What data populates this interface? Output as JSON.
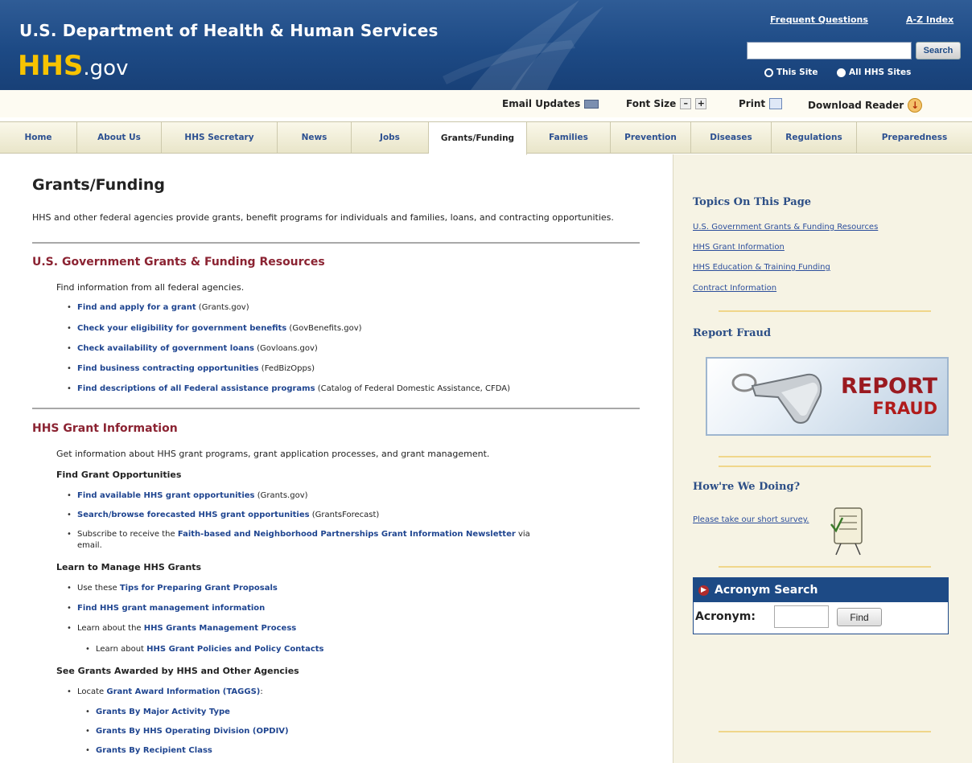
{
  "header": {
    "dept_title": "U.S. Department of Health & Human Services",
    "logo_hhs": "HHS",
    "logo_gov": ".gov",
    "faq_link": "Frequent Questions",
    "az_link": "A-Z Index",
    "search_placeholder": "",
    "search_button": "Search",
    "radio_this": "This Site",
    "radio_all": "All HHS Sites"
  },
  "utility": {
    "email": "Email Updates",
    "font_size": "Font Size",
    "font_minus": "–",
    "font_plus": "+",
    "print": "Print",
    "download": "Download Reader"
  },
  "nav": {
    "tabs": [
      {
        "label": "Home"
      },
      {
        "label": "About Us"
      },
      {
        "label": "HHS Secretary"
      },
      {
        "label": "News"
      },
      {
        "label": "Jobs"
      },
      {
        "label": "Grants/Funding"
      },
      {
        "label": "Families"
      },
      {
        "label": "Prevention"
      },
      {
        "label": "Diseases"
      },
      {
        "label": "Regulations"
      },
      {
        "label": "Preparedness"
      }
    ]
  },
  "main": {
    "title": "Grants/Funding",
    "intro": "HHS and other federal agencies provide grants, benefit programs for individuals and families, loans, and contracting opportunities.",
    "s1": {
      "heading": "U.S. Government Grants & Funding Resources",
      "lead": "Find information from all federal agencies.",
      "items": [
        {
          "link": "Find and apply for a grant",
          "rest": " (Grants.gov)"
        },
        {
          "link": "Check your eligibility for government benefits",
          "rest": " (GovBenefits.gov)"
        },
        {
          "link": "Check availability of government loans",
          "rest": " (Govloans.gov)"
        },
        {
          "link": "Find business contracting opportunities",
          "rest": " (FedBizOpps)"
        },
        {
          "link": "Find descriptions of all Federal assistance programs",
          "rest": " (Catalog of Federal Domestic Assistance, CFDA)"
        }
      ]
    },
    "s2": {
      "heading": "HHS Grant Information",
      "lead": "Get information about HHS grant programs, grant application processes, and grant management.",
      "find_heading": "Find Grant Opportunities",
      "find_items": [
        {
          "pre": "",
          "link": "Find available HHS grant opportunities",
          "rest": " (Grants.gov)"
        },
        {
          "pre": "",
          "link": "Search/browse forecasted HHS grant opportunities",
          "rest": " (GrantsForecast)"
        },
        {
          "pre": "Subscribe to receive the ",
          "link": "Faith-based and Neighborhood Partnerships Grant Information Newsletter",
          "rest": " via"
        }
      ],
      "find_wrap": "email.",
      "learn_heading": "Learn to Manage HHS Grants",
      "learn_items": [
        {
          "pre": "Use these ",
          "link": "Tips for Preparing Grant Proposals",
          "rest": ""
        },
        {
          "pre": "",
          "link": "Find HHS grant management information",
          "rest": ""
        },
        {
          "pre": "Learn about the ",
          "link": "HHS Grants Management Process",
          "rest": ""
        }
      ],
      "learn_sub": {
        "pre": "Learn about ",
        "link": "HHS Grant Policies and Policy Contacts",
        "rest": ""
      },
      "awarded_heading": "See Grants Awarded by HHS and Other Agencies",
      "awarded_item": {
        "pre": "Locate ",
        "link": "Grant Award Information (TAGGS)",
        "rest": ":"
      },
      "awarded_sub": [
        "Grants By Major Activity Type",
        "Grants By HHS Operating Division (OPDIV)",
        "Grants By Recipient Class"
      ]
    }
  },
  "sidebar": {
    "topics_heading": "Topics On This Page",
    "topics": [
      "U.S. Government Grants & Funding Resources",
      "HHS Grant Information",
      "HHS Education & Training Funding",
      "Contract Information"
    ],
    "fraud_heading": "Report Fraud",
    "fraud_line1": "REPORT",
    "fraud_line2": "FRAUD",
    "doing_heading": "How're We Doing?",
    "survey_link": "Please take our short survey.",
    "acronym_heading": "Acronym Search",
    "acronym_label": "Acronym:",
    "acronym_value": "",
    "find_button": "Find"
  },
  "colors": {
    "header_blue": "#1d4a85",
    "logo_gold": "#f7c300",
    "section_heading": "#8b2332",
    "link_blue": "#1f4590",
    "sidebar_bg": "#f6f3e4"
  }
}
